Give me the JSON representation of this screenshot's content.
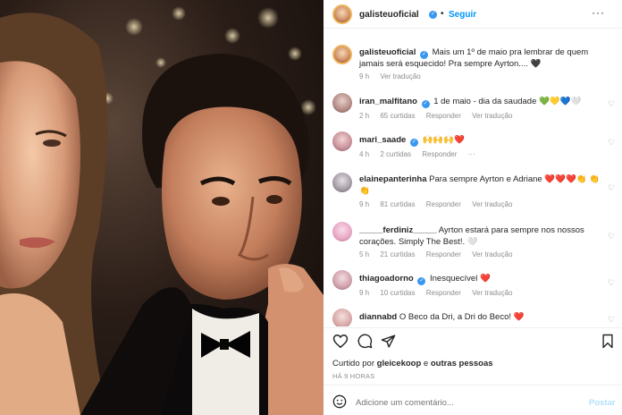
{
  "header": {
    "username": "galisteuoficial",
    "separator": "•",
    "follow_label": "Seguir",
    "more_label": "···"
  },
  "caption": {
    "username": "galisteuoficial",
    "text": "Mais um 1º de maio pra lembrar de quem jamais será esquecido! Pra sempre Ayrton....",
    "emoji": "🖤",
    "time": "9 h",
    "translate": "Ver tradução"
  },
  "comments": [
    {
      "username": "iran_malfitano",
      "verified": true,
      "text": "1 de maio - dia da saudade",
      "emoji": "💚💛💙🤍",
      "time": "2 h",
      "likes": "65 curtidas",
      "reply": "Responder",
      "translate": "Ver tradução"
    },
    {
      "username": "mari_saade",
      "verified": true,
      "text": "",
      "emoji": "🙌🙌🙌❤️",
      "time": "4 h",
      "likes": "2 curtidas",
      "reply": "Responder",
      "translate": ""
    },
    {
      "username": "elainepanterinha",
      "verified": false,
      "text": "Para sempre Ayrton e Adriane",
      "emoji": "❤️❤️❤️👏 👏👏",
      "time": "9 h",
      "likes": "81 curtidas",
      "reply": "Responder",
      "translate": "Ver tradução"
    },
    {
      "username": "_____ferdiniz_____",
      "verified": false,
      "text": "Ayrton estará para sempre nos nossos corações. Simply The Best!.",
      "emoji": "🤍",
      "time": "5 h",
      "likes": "21 curtidas",
      "reply": "Responder",
      "translate": "Ver tradução"
    },
    {
      "username": "thiagoadorno",
      "verified": true,
      "text": "Inesquecível",
      "emoji": "❤️",
      "time": "9 h",
      "likes": "10 curtidas",
      "reply": "Responder",
      "translate": "Ver tradução"
    },
    {
      "username": "diannabd",
      "verified": false,
      "text": "O Beco da Dri, a Dri do Beco!",
      "emoji": "❤️",
      "time": "",
      "likes": "",
      "reply": "",
      "translate": ""
    }
  ],
  "footer": {
    "liked_prefix": "Curtido por",
    "liked_user": "gleicekoop",
    "liked_suffix": "e",
    "liked_others": "outras pessoas",
    "time": "HÁ 9 HORAS",
    "add_comment_placeholder": "Adicione um comentário...",
    "post_label": "Postar"
  },
  "colors": {
    "accent": "#0095f6",
    "verified": "#3897f0",
    "muted": "#8e8e8e",
    "like_red": "#ed4956"
  }
}
